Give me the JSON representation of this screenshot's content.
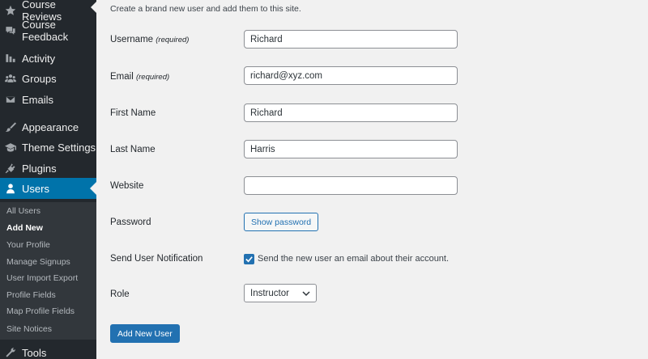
{
  "sidebar": {
    "items": [
      {
        "label": "Course Reviews",
        "icon": "star-icon"
      },
      {
        "label": "Course Feedback",
        "icon": "comments-icon"
      },
      {
        "label": "Activity",
        "icon": "activity-icon"
      },
      {
        "label": "Groups",
        "icon": "groups-icon"
      },
      {
        "label": "Emails",
        "icon": "email-icon"
      },
      {
        "label": "Appearance",
        "icon": "paintbrush-icon"
      },
      {
        "label": "Theme Settings",
        "icon": "graduation-cap-icon"
      },
      {
        "label": "Plugins",
        "icon": "plugin-icon"
      },
      {
        "label": "Users",
        "icon": "user-icon"
      }
    ],
    "submenu": [
      "All Users",
      "Add New",
      "Your Profile",
      "Manage Signups",
      "User Import Export",
      "Profile Fields",
      "Map Profile Fields",
      "Site Notices"
    ],
    "tools": {
      "label": "Tools",
      "icon": "wrench-icon"
    }
  },
  "page": {
    "intro": "Create a brand new user and add them to this site."
  },
  "form": {
    "username": {
      "label": "Username",
      "hint": "(required)",
      "value": "Richard"
    },
    "email": {
      "label": "Email",
      "hint": "(required)",
      "value": "richard@xyz.com"
    },
    "first_name": {
      "label": "First Name",
      "value": "Richard"
    },
    "last_name": {
      "label": "Last Name",
      "value": "Harris"
    },
    "website": {
      "label": "Website",
      "value": ""
    },
    "password": {
      "label": "Password",
      "button": "Show password"
    },
    "notification": {
      "label": "Send User Notification",
      "checkbox_label": "Send the new user an email about their account.",
      "checked": true
    },
    "role": {
      "label": "Role",
      "value": "Instructor"
    },
    "submit": "Add New User"
  },
  "colors": {
    "sidebar_bg": "#23282d",
    "submenu_bg": "#32373c",
    "accent": "#0073aa",
    "button_primary": "#2271b1"
  }
}
